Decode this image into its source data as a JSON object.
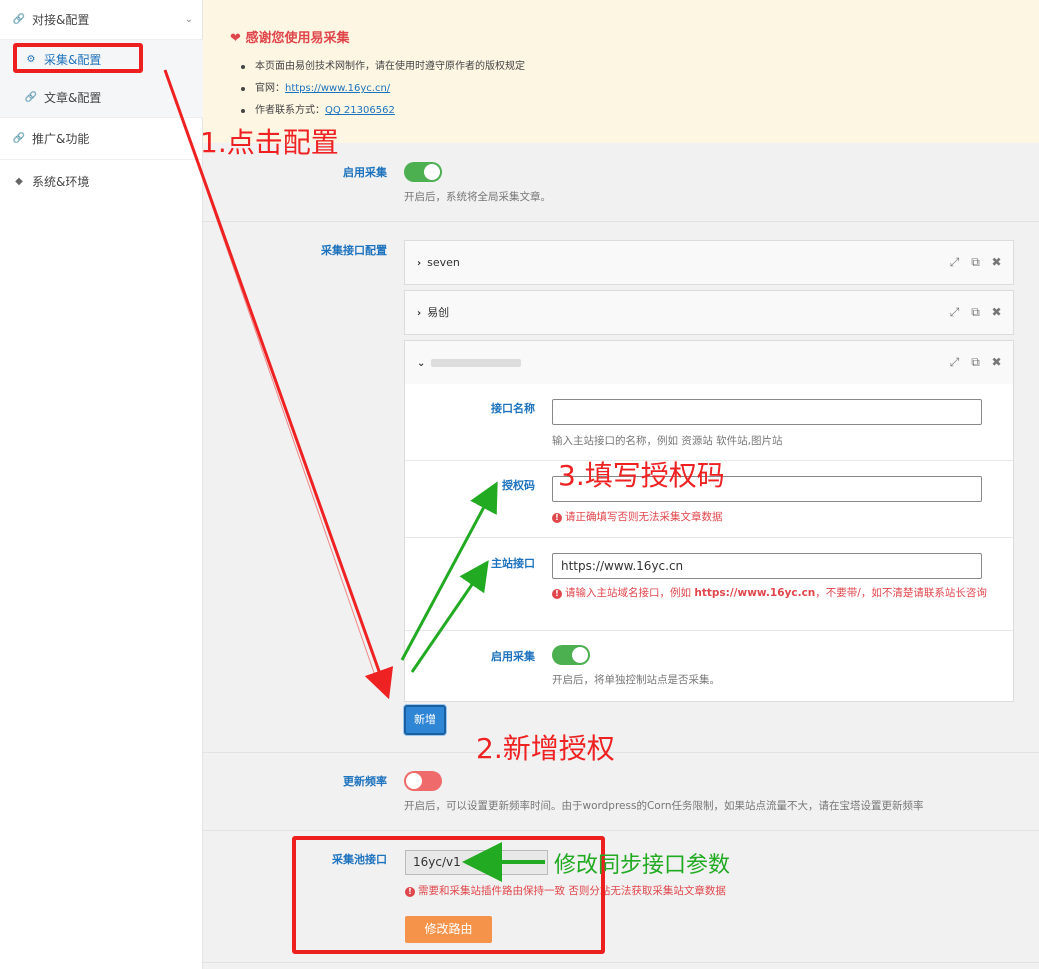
{
  "sidebar": {
    "items": [
      {
        "label": "对接&配置",
        "icon": "link-icon"
      },
      {
        "label": "采集&配置",
        "icon": "gear-icon"
      },
      {
        "label": "文章&配置",
        "icon": "link-icon"
      },
      {
        "label": "推广&功能",
        "icon": "link-icon"
      },
      {
        "label": "系统&环境",
        "icon": "brand-icon"
      }
    ]
  },
  "notice": {
    "title": "感谢您使用易采集",
    "line1": "本页面由易创技术网制作，请在使用时遵守原作者的版权规定",
    "line2_prefix": "官网：",
    "line2_link": "https://www.16yc.cn/",
    "line3_prefix": "作者联系方式：",
    "line3_link": "QQ 21306562"
  },
  "enable_collect": {
    "label": "启用采集",
    "desc": "开启后，系统将全局采集文章。",
    "state": "on"
  },
  "api_config": {
    "label": "采集接口配置",
    "panels": [
      {
        "title": "seven",
        "expanded": false
      },
      {
        "title": "易创",
        "expanded": false
      },
      {
        "title": "",
        "expanded": true
      }
    ],
    "fields": {
      "name_label": "接口名称",
      "name_value": "",
      "name_desc": "输入主站接口的名称，例如 资源站 软件站,图片站",
      "auth_label": "授权码",
      "auth_value": "",
      "auth_err": "请正确填写否则无法采集文章数据",
      "host_label": "主站接口",
      "host_value": "https://www.16yc.cn",
      "host_err_pre": "请输入主站域名接口，例如 ",
      "host_err_bold": "https://www.16yc.cn",
      "host_err_post": "，不要带/，如不清楚请联系站长咨询",
      "enable_label": "启用采集",
      "enable_desc": "开启后，将单独控制站点是否采集。"
    },
    "add_button": "新增"
  },
  "update_freq": {
    "label": "更新频率",
    "desc": "开启后，可以设置更新频率时间。由于wordpress的Corn任务限制，如果站点流量不大，请在宝塔设置更新频率",
    "state": "off"
  },
  "pool_api": {
    "label": "采集池接口",
    "value": "16yc/v1",
    "err": "需要和采集站插件路由保持一致 否则分站无法获取采集站文章数据",
    "button": "修改路由"
  },
  "annotations": {
    "step1": "1.点击配置",
    "step2": "2.新增授权",
    "step3": "3.填写授权码",
    "sync": "修改同步接口参数"
  },
  "colors": {
    "accent": "#1e73be",
    "toggle_on": "#4caf50",
    "toggle_off": "#ef6b6b",
    "error": "#e0474c",
    "annotation_red": "#ee2222",
    "annotation_green": "#22aa22"
  }
}
